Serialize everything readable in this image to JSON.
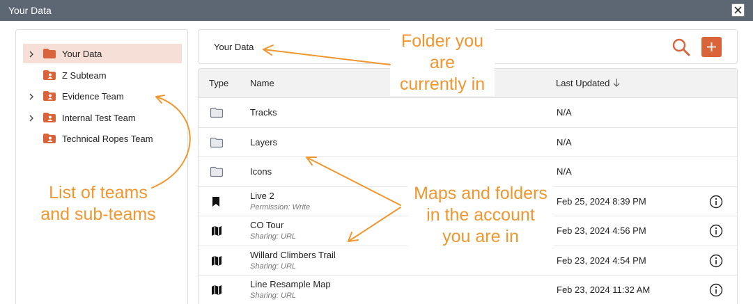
{
  "window": {
    "title": "Your Data",
    "close_icon": "close-icon"
  },
  "sidebar": {
    "items": [
      {
        "label": "Your Data",
        "expandable": true,
        "selected": true,
        "icon": "folder-icon"
      },
      {
        "label": "Z Subteam",
        "expandable": false,
        "selected": false,
        "icon": "team-folder-icon"
      },
      {
        "label": "Evidence Team",
        "expandable": true,
        "selected": false,
        "icon": "team-folder-icon"
      },
      {
        "label": "Internal Test Team",
        "expandable": true,
        "selected": false,
        "icon": "team-folder-icon"
      },
      {
        "label": "Technical Ropes Team",
        "expandable": false,
        "selected": false,
        "icon": "team-folder-icon"
      }
    ]
  },
  "header": {
    "breadcrumb": "Your Data",
    "search_icon": "search-icon",
    "add_icon": "plus-icon"
  },
  "table": {
    "columns": {
      "type": "Type",
      "name": "Name",
      "updated": "Last Updated"
    },
    "sort_icon": "arrow-down-icon",
    "rows": [
      {
        "type": "folder",
        "name": "Tracks",
        "sub": "",
        "updated": "N/A",
        "info": false
      },
      {
        "type": "folder",
        "name": "Layers",
        "sub": "",
        "updated": "N/A",
        "info": false
      },
      {
        "type": "folder",
        "name": "Icons",
        "sub": "",
        "updated": "N/A",
        "info": false
      },
      {
        "type": "bookmark",
        "name": "Live 2",
        "sub": "Permission: Write",
        "updated": "Feb 25, 2024 8:39 PM",
        "info": true
      },
      {
        "type": "map",
        "name": "CO Tour",
        "sub": "Sharing: URL",
        "updated": "Feb 23, 2024 4:56 PM",
        "info": true
      },
      {
        "type": "map",
        "name": "Willard Climbers Trail",
        "sub": "Sharing: URL",
        "updated": "Feb 23, 2024 4:54 PM",
        "info": true
      },
      {
        "type": "map",
        "name": "Line Resample Map",
        "sub": "Sharing: URL",
        "updated": "Feb 23, 2024 11:32 AM",
        "info": true
      }
    ]
  },
  "annotations": {
    "folder": {
      "line1": "Folder you",
      "line2": "are",
      "line3": "currently in"
    },
    "teams": {
      "line1": "List of teams",
      "line2": "and sub-teams"
    },
    "maps": {
      "line1": "Maps and folders",
      "line2": "in the account",
      "line3": "you are in"
    }
  },
  "colors": {
    "accent": "#d9643a",
    "annotation": "#f0962f",
    "titlebar": "#5d6673",
    "selected_bg": "#f6dfd7"
  }
}
